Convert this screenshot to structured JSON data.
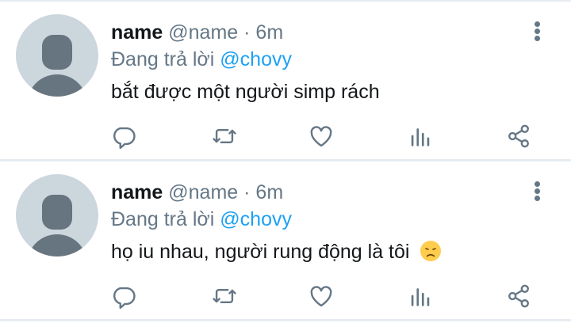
{
  "colors": {
    "text_primary": "#14171a",
    "text_secondary": "#657786",
    "mention": "#1da1f2",
    "avatar_bg": "#ccd6dd",
    "avatar_fg": "#66757f",
    "divider": "#e6ecf0"
  },
  "tweets": [
    {
      "display_name": "name",
      "handle": "@name",
      "separator": "·",
      "time": "6m",
      "reply_prefix": "Đang trả lời",
      "reply_mention": "@chovy",
      "text": "bắt được một người simp rách",
      "emoji": null,
      "icons": [
        "reply-icon",
        "retweet-icon",
        "like-icon",
        "analytics-icon",
        "share-icon",
        "more-icon"
      ]
    },
    {
      "display_name": "name",
      "handle": "@name",
      "separator": "·",
      "time": "6m",
      "reply_prefix": "Đang trả lời",
      "reply_mention": "@chovy",
      "text": "họ iu nhau, người rung động là tôi",
      "emoji": "disappointed-face-emoji",
      "icons": [
        "reply-icon",
        "retweet-icon",
        "like-icon",
        "analytics-icon",
        "share-icon",
        "more-icon"
      ]
    }
  ]
}
